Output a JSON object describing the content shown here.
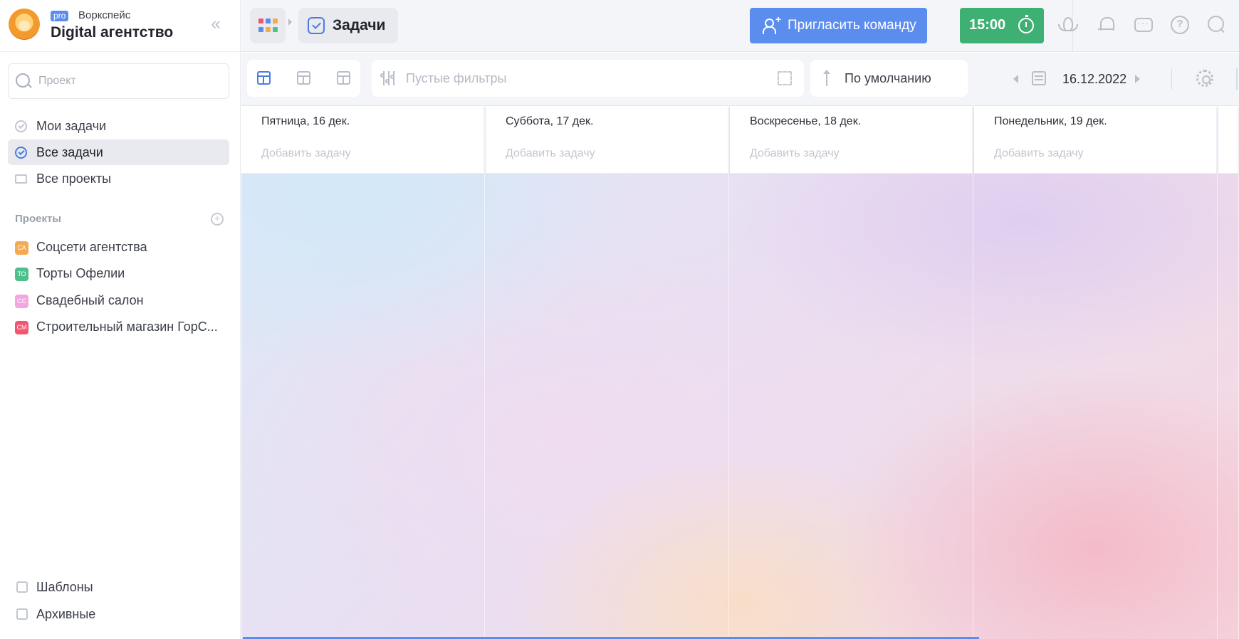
{
  "workspace": {
    "badge": "pro",
    "name": "Воркспейс",
    "title": "Digital агентство",
    "collapse_icon": "chevrons-left-icon"
  },
  "sidebar": {
    "search_placeholder": "Проект",
    "nav": [
      {
        "label": "Мои задачи",
        "icon": "check-circle-icon",
        "active": false
      },
      {
        "label": "Все задачи",
        "icon": "check-circle-icon",
        "active": true
      },
      {
        "label": "Все проекты",
        "icon": "folder-icon",
        "active": false
      }
    ],
    "projects_title": "Проекты",
    "projects": [
      {
        "badge": "СА",
        "label": "Соцсети агентства",
        "color": "#f6a94e"
      },
      {
        "badge": "ТО",
        "label": "Торты Офелии",
        "color": "#4fc08d"
      },
      {
        "badge": "СС",
        "label": "Свадебный салон",
        "color": "#f3a6e0"
      },
      {
        "badge": "СМ",
        "label": "Строительный магазин ГорС...",
        "color": "#f0576e"
      }
    ],
    "bottom": [
      {
        "label": "Шаблоны",
        "icon": "templates-icon"
      },
      {
        "label": "Архивные",
        "icon": "archive-icon"
      }
    ]
  },
  "topbar": {
    "page_title": "Задачи",
    "invite_label": "Пригласить команду",
    "timer_label": "15:00"
  },
  "toolbar": {
    "filters_label": "Пустые фильтры",
    "sort_label": "По умолчанию",
    "date_label": "16.12.2022"
  },
  "days": [
    {
      "title": "Пятница, 16 дек.",
      "add": "Добавить задачу"
    },
    {
      "title": "Суббота, 17 дек.",
      "add": "Добавить задачу"
    },
    {
      "title": "Воскресенье, 18 дек.",
      "add": "Добавить задачу"
    },
    {
      "title": "Понедельник, 19 дек.",
      "add": "Добавить задачу"
    }
  ],
  "colors": {
    "accent": "#5b8def",
    "timer": "#3fb073",
    "active_check": "#4c7be0"
  }
}
